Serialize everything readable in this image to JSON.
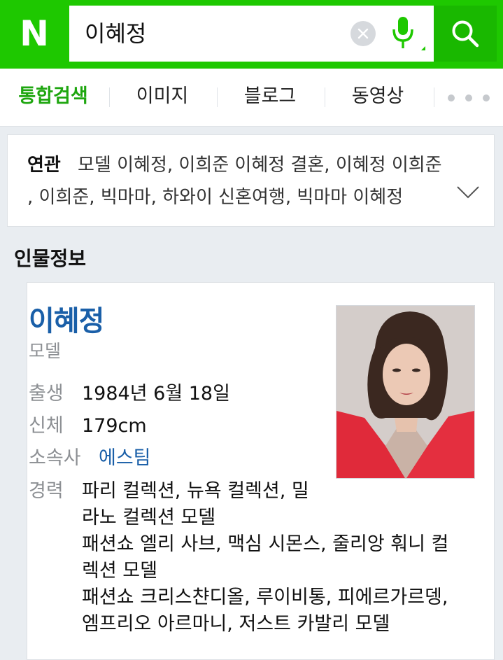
{
  "header": {
    "logo": "N",
    "query": "이혜정",
    "colors": {
      "brand": "#1ec800",
      "search_button": "#19b800"
    }
  },
  "tabs": [
    {
      "label": "통합검색",
      "active": true
    },
    {
      "label": "이미지",
      "active": false
    },
    {
      "label": "블로그",
      "active": false
    },
    {
      "label": "동영상",
      "active": false
    }
  ],
  "related": {
    "label": "연관",
    "line1": "모델 이혜정, 이희준 이혜정 결혼, 이혜정 이희준",
    "line2": ", 이희준, 빅마마, 하와이 신혼여행, 빅마마 이혜정"
  },
  "profile": {
    "section_title": "인물정보",
    "name": "이혜정",
    "occupation": "모델",
    "birth_label": "출생",
    "birth_value": "1984년 6월 18일",
    "body_label": "신체",
    "body_value": "179cm",
    "agency_label": "소속사",
    "agency_value": "에스팀",
    "career_label": "경력",
    "career_lines": [
      "파리 컬렉션, 뉴욕 컬렉션, 밀",
      "라노 컬렉션 모델",
      "패션쇼 엘리 사브, 맥심 시몬스, 줄리앙 훠니 컬",
      "렉션 모델",
      "패션쇼 크리스챤디올, 루이비통, 피에르가르뎅,",
      "엠프리오 아르마니, 저스트 카발리 모델"
    ]
  }
}
